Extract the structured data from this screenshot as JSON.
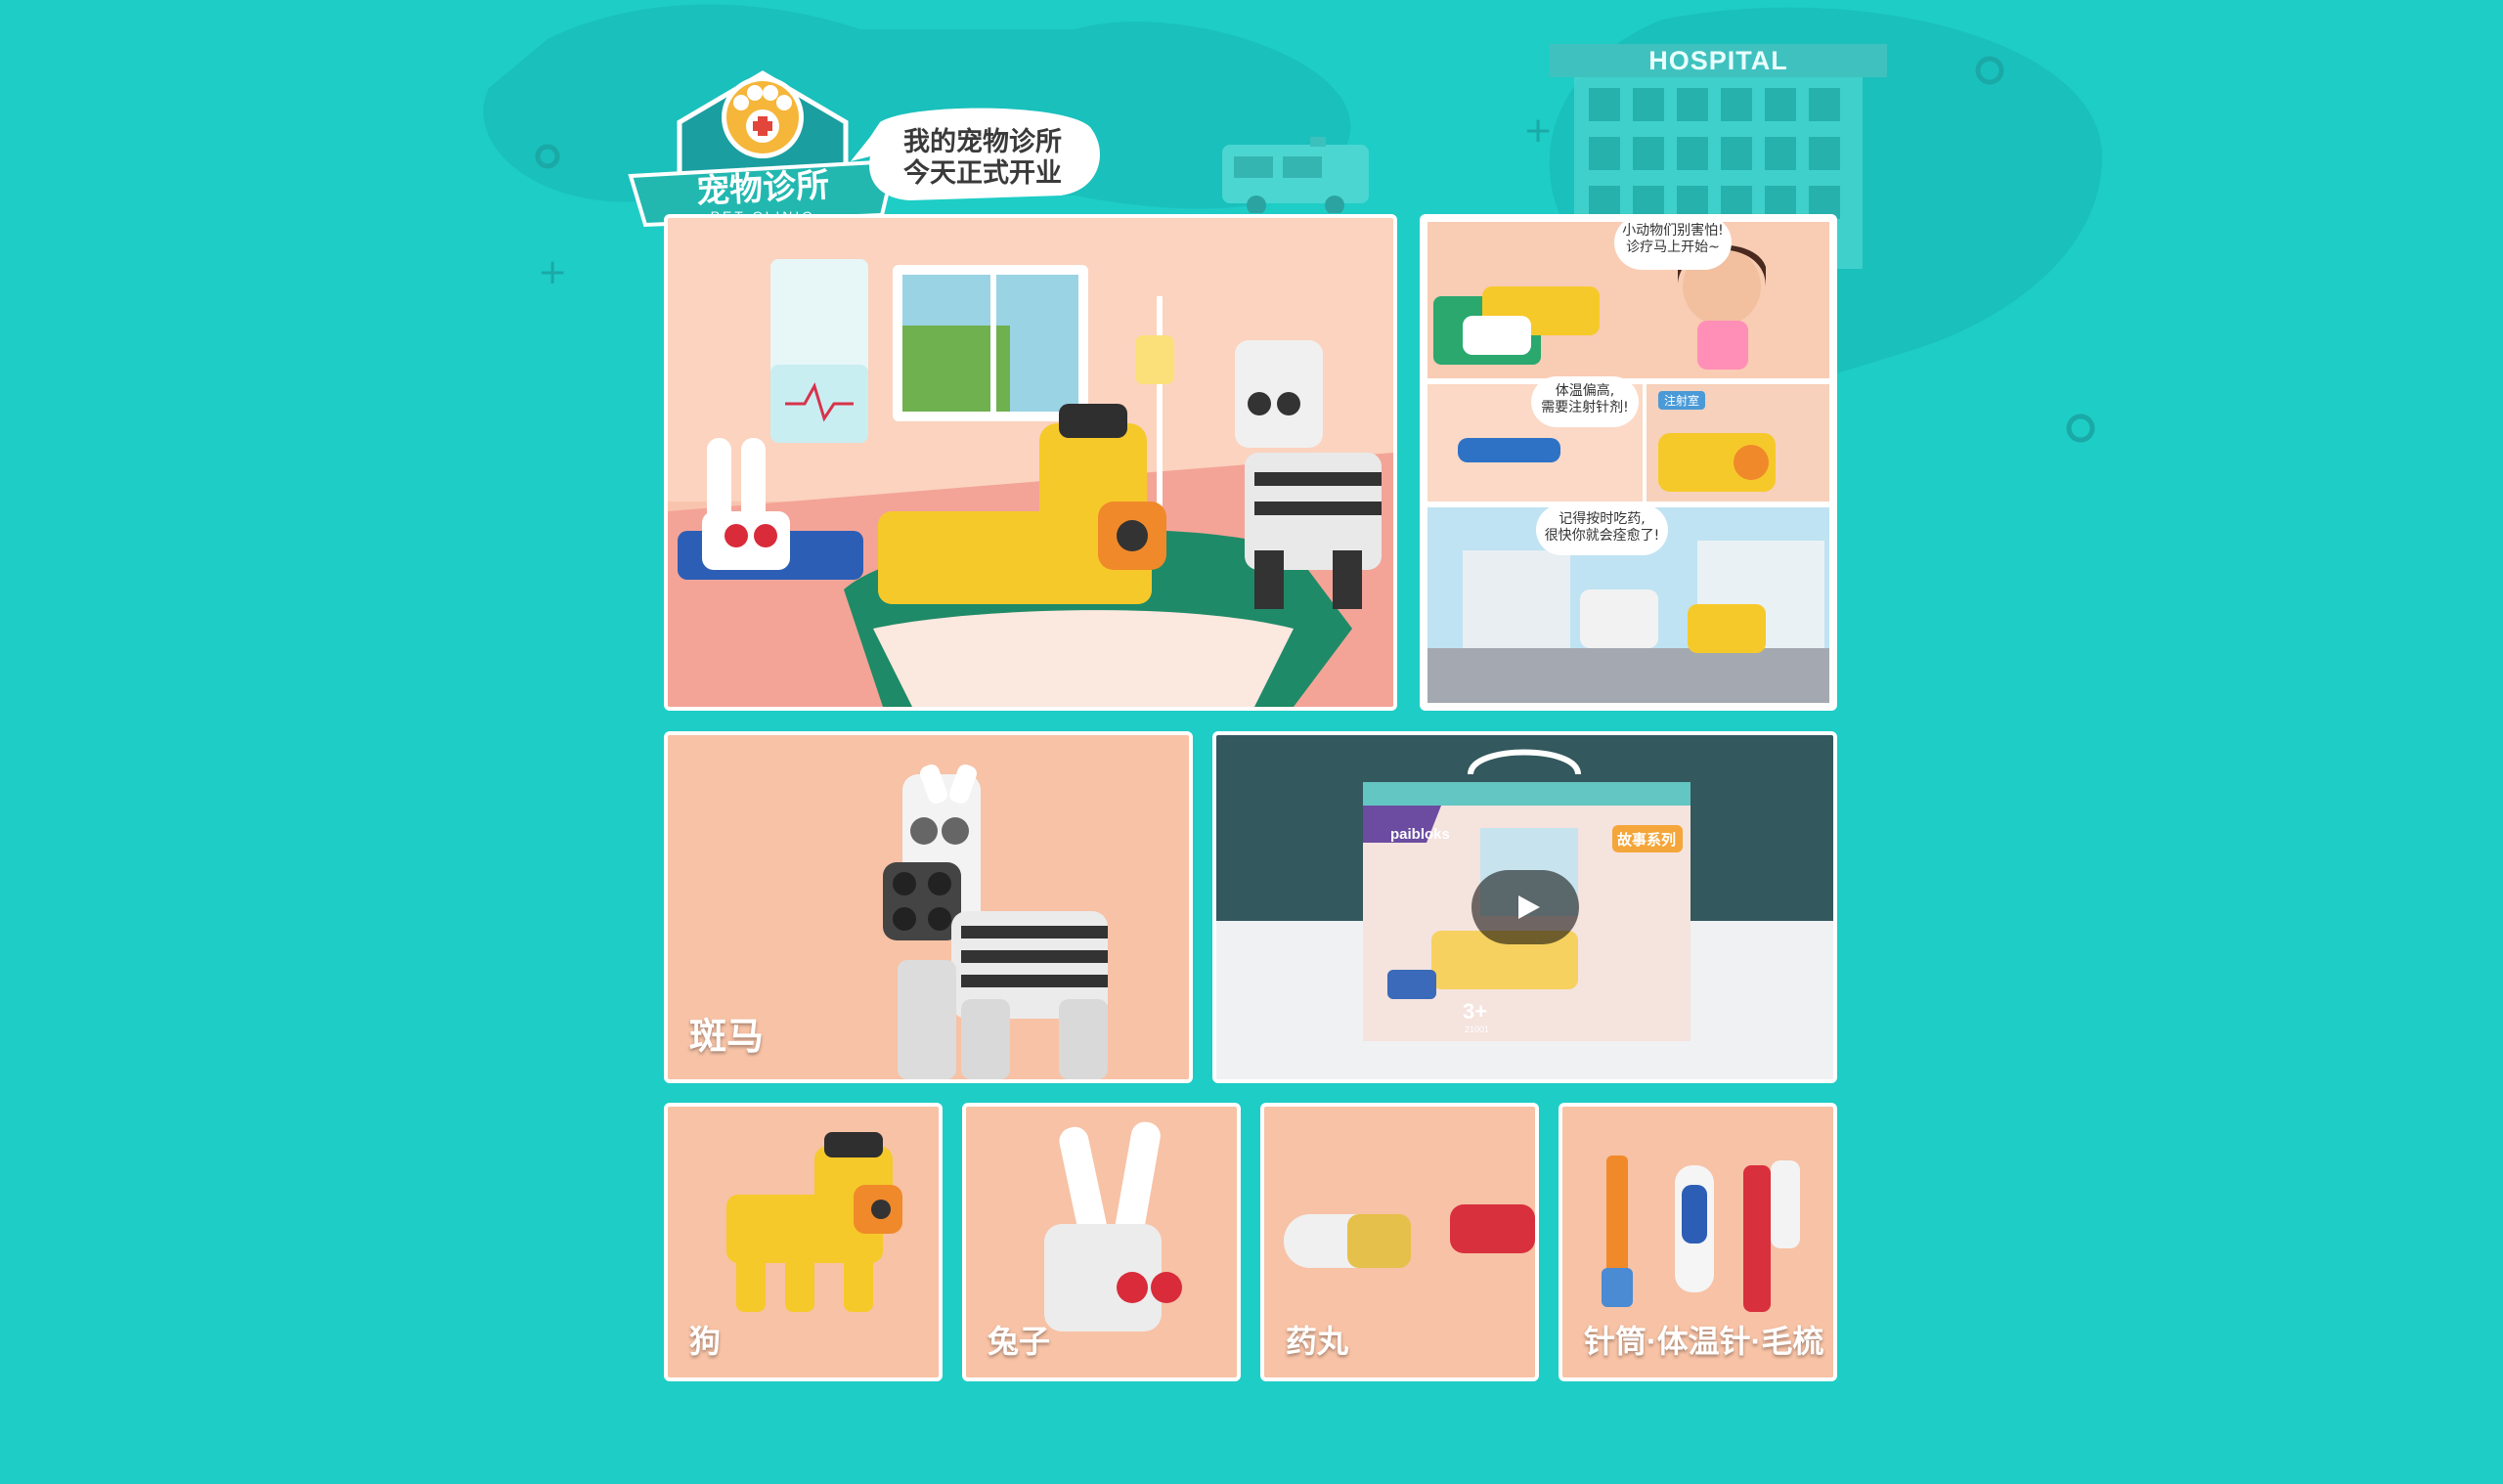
{
  "header": {
    "logo_title": "宠物诊所",
    "logo_subtitle": "PET CLINIC",
    "speech_line1": "我的宠物诊所",
    "speech_line2": "今天正式开业",
    "hospital_sign": "HOSPITAL"
  },
  "story": {
    "bubble1_line1": "小动物们别害怕!",
    "bubble1_line2": "诊疗马上开始~",
    "bubble2_line1": "体温偏高,",
    "bubble2_line2": "需要注射针剂!",
    "bubble3_line1": "记得按时吃药,",
    "bubble3_line2": "很快你就会痊愈了!",
    "room_tag": "注射室"
  },
  "video": {
    "brand": "paibloks",
    "series": "故事系列",
    "age": "3+",
    "code": "21001"
  },
  "tiles": {
    "zebra": "斑马",
    "dog": "狗",
    "rabbit": "兔子",
    "pill": "药丸",
    "tools": "针筒·体温针·毛梳"
  },
  "colors": {
    "background": "#1ecdc6",
    "tile": "#f7c2a5",
    "frame": "#ffffff"
  }
}
